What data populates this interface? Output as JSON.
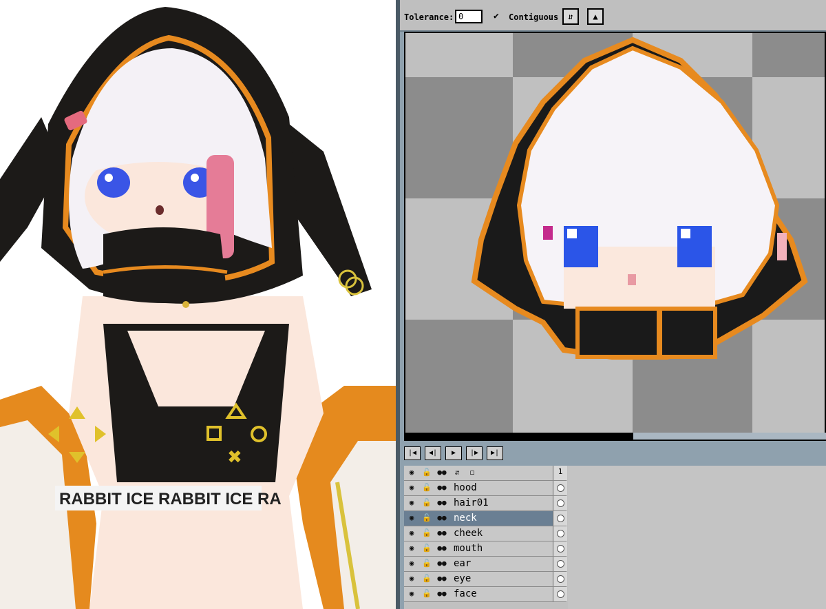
{
  "toolbar": {
    "tolerance_label": "Tolerance:",
    "tolerance_value": "0",
    "contiguous_label": "Contiguous",
    "contiguous_checked": true,
    "tool_icons": [
      "transform-icon",
      "bucket-icon"
    ]
  },
  "reference": {
    "shirt_text": "RABBIT ICE RABBIT ICE RA",
    "colors": {
      "hood": "#1c1a18",
      "trim": "#e78a1f",
      "hair": "#f4f1f6",
      "skin": "#fbe7dc",
      "eyes": "#2b55e8",
      "pink": "#e56c8c"
    }
  },
  "canvas": {
    "checker_light": "#c0c0c0",
    "checker_dark": "#8c8c8c"
  },
  "playback": {
    "buttons": [
      "first-frame-icon",
      "prev-frame-icon",
      "play-icon",
      "next-frame-icon",
      "last-frame-icon"
    ]
  },
  "layers": {
    "frame_header": "1",
    "items": [
      {
        "name": "hood",
        "selected": false
      },
      {
        "name": "hair01",
        "selected": false
      },
      {
        "name": "neck",
        "selected": true
      },
      {
        "name": "cheek",
        "selected": false
      },
      {
        "name": "mouth",
        "selected": false
      },
      {
        "name": "ear",
        "selected": false
      },
      {
        "name": "eye",
        "selected": false
      },
      {
        "name": "face",
        "selected": false
      }
    ]
  }
}
